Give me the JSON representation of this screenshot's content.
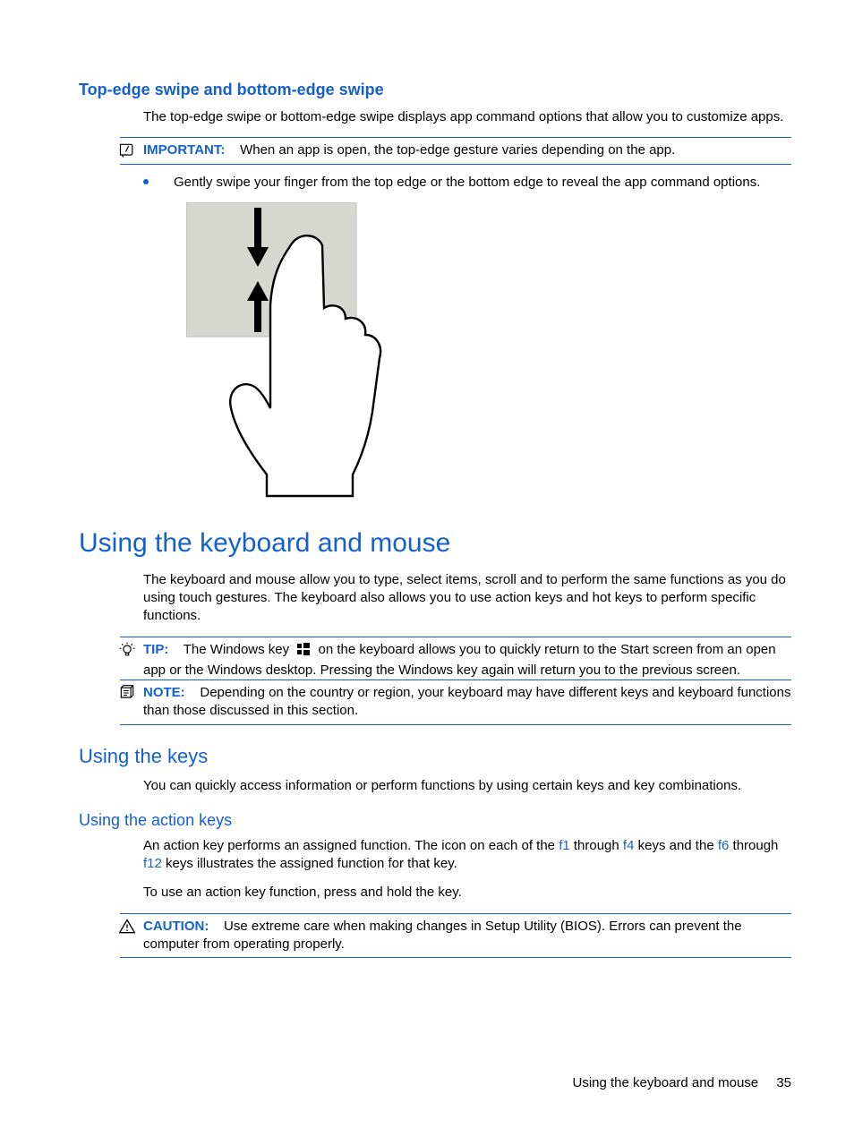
{
  "section1": {
    "heading": "Top-edge swipe and bottom-edge swipe",
    "body": "The top-edge swipe or bottom-edge swipe displays app command options that allow you to customize apps.",
    "important_label": "IMPORTANT:",
    "important_text": "When an app is open, the top-edge gesture varies depending on the app.",
    "bullet": "Gently swipe your finger from the top edge or the bottom edge to reveal the app command options."
  },
  "section2": {
    "heading": "Using the keyboard and mouse",
    "body": "The keyboard and mouse allow you to type, select items, scroll and to perform the same functions as you do using touch gestures. The keyboard also allows you to use action keys and hot keys to perform specific functions.",
    "tip_label": "TIP:",
    "tip_text_a": "The Windows key",
    "tip_text_b": "on the keyboard allows you to quickly return to the Start screen from an open app or the Windows desktop. Pressing the Windows key again will return you to the previous screen.",
    "note_label": "NOTE:",
    "note_text": "Depending on the country or region, your keyboard may have different keys and keyboard functions than those discussed in this section."
  },
  "section3": {
    "heading": "Using the keys",
    "body": "You can quickly access information or perform functions by using certain keys and key combinations."
  },
  "section4": {
    "heading": "Using the action keys",
    "body_a": "An action key performs an assigned function. The icon on each of the ",
    "f1": "f1",
    "body_b": " through ",
    "f4": "f4",
    "body_c": " keys and the ",
    "f6": "f6",
    "body_d": " through ",
    "f12": "f12",
    "body_e": " keys illustrates the assigned function for that key.",
    "body2": "To use an action key function, press and hold the key.",
    "caution_label": "CAUTION:",
    "caution_text": "Use extreme care when making changes in Setup Utility (BIOS). Errors can prevent the computer from operating properly."
  },
  "footer": {
    "text": "Using the keyboard and mouse",
    "page": "35"
  }
}
